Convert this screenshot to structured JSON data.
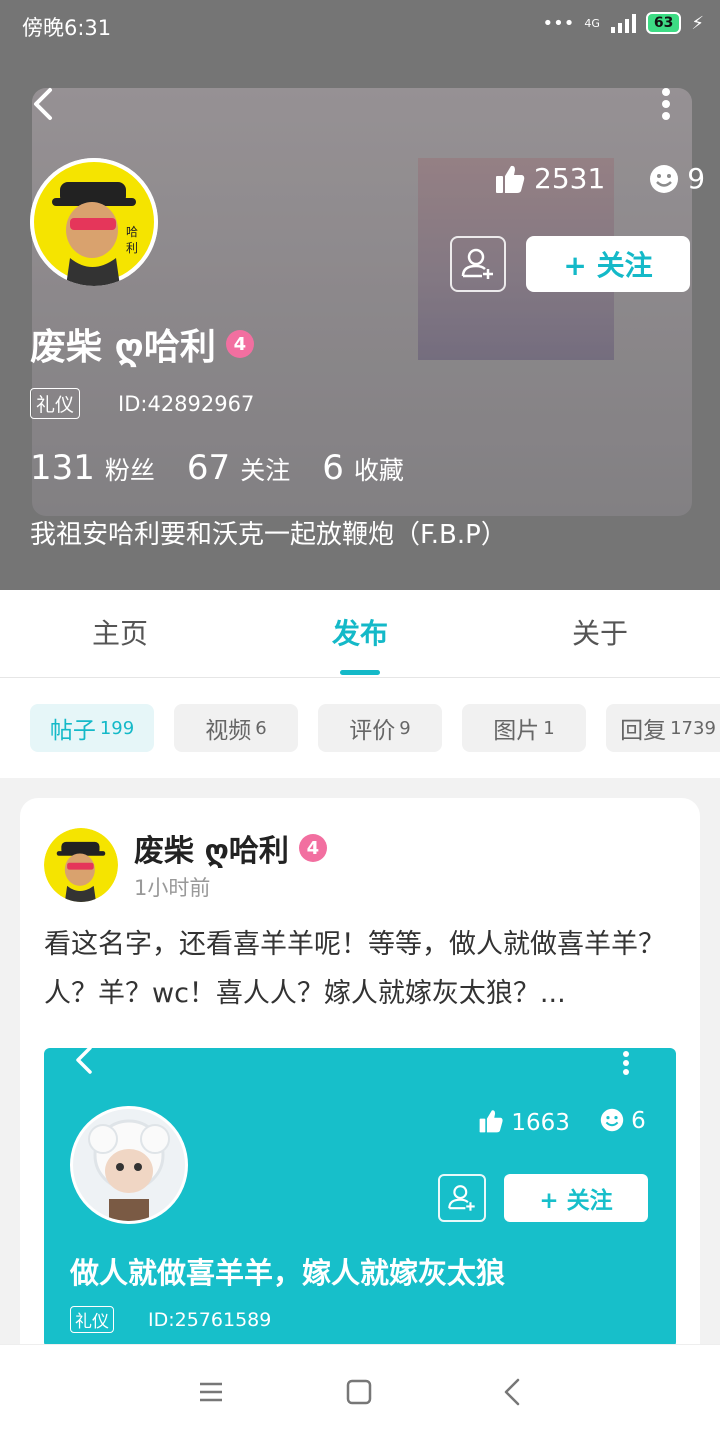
{
  "status_bar": {
    "time": "傍晚6:31",
    "network": "4G",
    "battery": "63"
  },
  "profile": {
    "name": "废柴 ღ哈利",
    "level": "4",
    "likes": "2531",
    "smiles": "9",
    "follow_label": "+ 关注",
    "etiquette_tag": "礼仪",
    "user_id": "ID:42892967",
    "counts": [
      {
        "num": "131",
        "label": "粉丝"
      },
      {
        "num": "67",
        "label": "关注"
      },
      {
        "num": "6",
        "label": "收藏"
      }
    ],
    "signature": "我祖安哈利要和沃克一起放鞭炮（F.B.P）"
  },
  "tabs": [
    "主页",
    "发布",
    "关于"
  ],
  "active_tab": "发布",
  "filters": [
    {
      "label": "帖子",
      "count": "199"
    },
    {
      "label": "视频",
      "count": "6"
    },
    {
      "label": "评价",
      "count": "9"
    },
    {
      "label": "图片",
      "count": "1"
    },
    {
      "label": "回复",
      "count": "1739"
    }
  ],
  "post": {
    "author": "废柴 ღ哈利",
    "level": "4",
    "time": "1小时前",
    "text": "看这名字，还看喜羊羊呢！等等，做人就做喜羊羊？人？羊？wc！喜人人？嫁人就嫁灰太狼？...",
    "embed": {
      "likes": "1663",
      "smiles": "6",
      "follow_label": "+ 关注",
      "title": "做人就做喜羊羊，嫁人就嫁灰太狼",
      "etiquette_tag": "礼仪",
      "user_id": "ID:25761589"
    }
  },
  "colors": {
    "accent": "#14b9c8",
    "level_badge": "#f26fa0"
  }
}
